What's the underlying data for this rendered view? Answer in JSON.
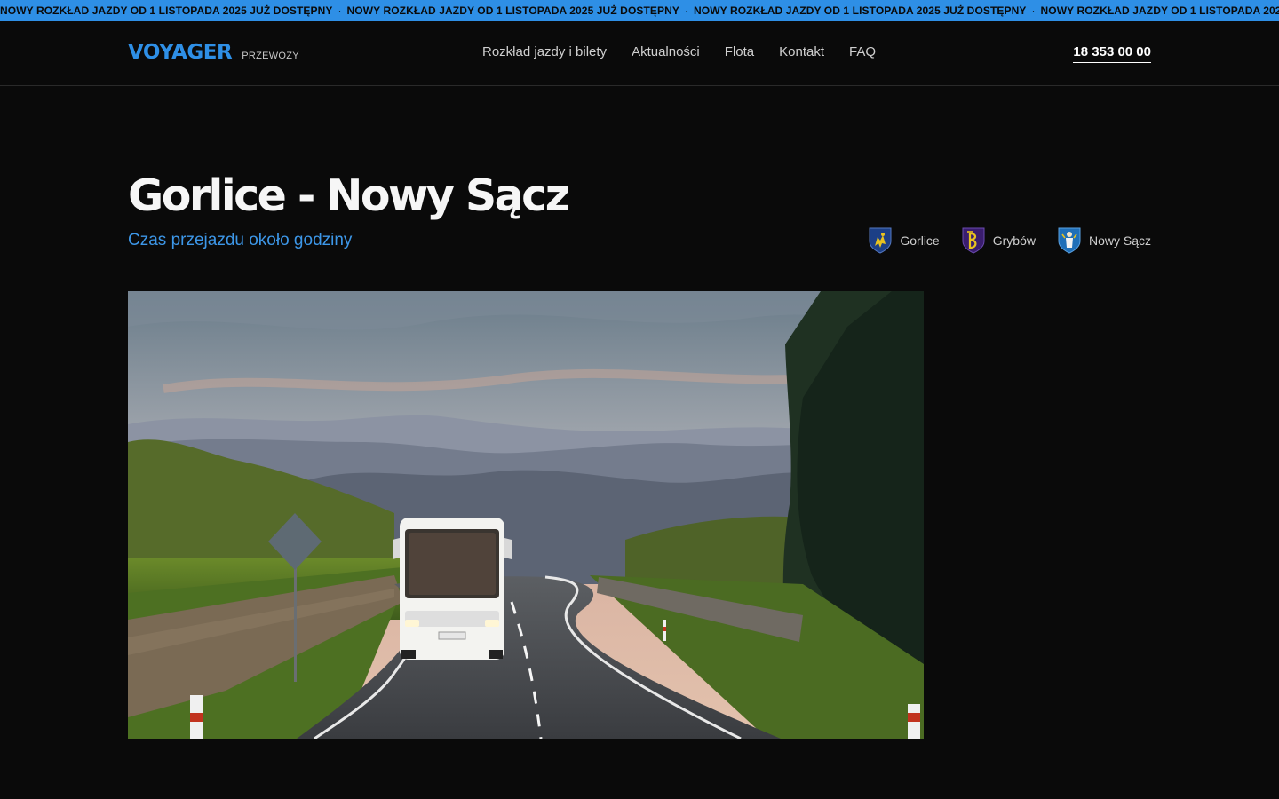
{
  "ticker": {
    "message": "NOWY ROZKŁAD JAZDY OD 1 LISTOPADA 2025 JUŻ DOSTĘPNY",
    "separator": "·",
    "color": "#2e8fe6"
  },
  "header": {
    "logo_main": "VOYAGER",
    "logo_sub": "PRZEWOZY",
    "nav": [
      {
        "label": "Rozkład jazdy i bilety"
      },
      {
        "label": "Aktualności"
      },
      {
        "label": "Flota"
      },
      {
        "label": "Kontakt"
      },
      {
        "label": "FAQ"
      }
    ],
    "phone": "18 353 00 00"
  },
  "hero": {
    "title": "Gorlice - Nowy Sącz",
    "subtitle": "Czas przejazdu około godziny",
    "towns": [
      {
        "label": "Gorlice",
        "icon": "gorlice-crest-icon"
      },
      {
        "label": "Grybów",
        "icon": "grybow-crest-icon"
      },
      {
        "label": "Nowy Sącz",
        "icon": "nowy-sacz-crest-icon"
      }
    ]
  },
  "colors": {
    "accent": "#2e8fe6",
    "background": "#0a0a0a"
  }
}
